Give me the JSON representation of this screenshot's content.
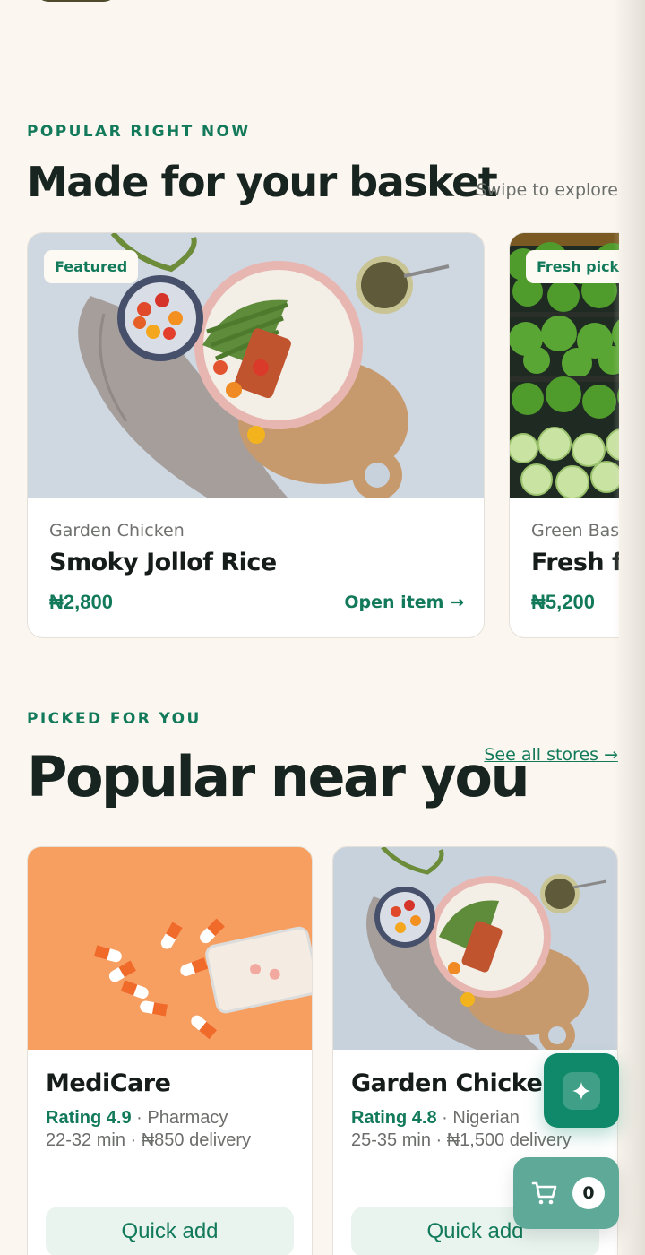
{
  "popular_section": {
    "eyebrow": "POPULAR RIGHT NOW",
    "title": "Made for your basket",
    "swipe_hint": "Swipe to explore",
    "cards": [
      {
        "badge": "Featured",
        "store": "Garden Chicken",
        "name": "Smoky Jollof Rice",
        "price": "₦2,800",
        "open_label": "Open item →",
        "image": "food-bowl-image"
      },
      {
        "badge": "Fresh pick",
        "store": "Green Bask",
        "name": "Fresh fr",
        "price": "₦5,200",
        "image": "vegetable-market-image"
      }
    ]
  },
  "stores_section": {
    "eyebrow": "PICKED FOR YOU",
    "title": "Popular near you",
    "see_all_label": "See all stores →",
    "stores": [
      {
        "name": "MediCare",
        "rating": "Rating 4.9",
        "category": " · Pharmacy",
        "eta_delivery": "22-32 min · ₦850 delivery",
        "quick_add": "Quick add",
        "image": "pills-image"
      },
      {
        "name": "Garden Chicken",
        "rating": "Rating 4.8",
        "category": " · Nigerian",
        "eta_delivery": "25-35 min · ₦1,500 delivery",
        "quick_add": "Quick add",
        "image": "food-bowl-image"
      }
    ]
  },
  "floating": {
    "ai_icon": "sparkle-icon",
    "cart_icon": "cart-icon",
    "cart_count": "0"
  },
  "colors": {
    "background": "#fbf7f0",
    "accent": "#127a5a",
    "accent_light": "#e9f4ef",
    "text_dark": "#17241f"
  }
}
